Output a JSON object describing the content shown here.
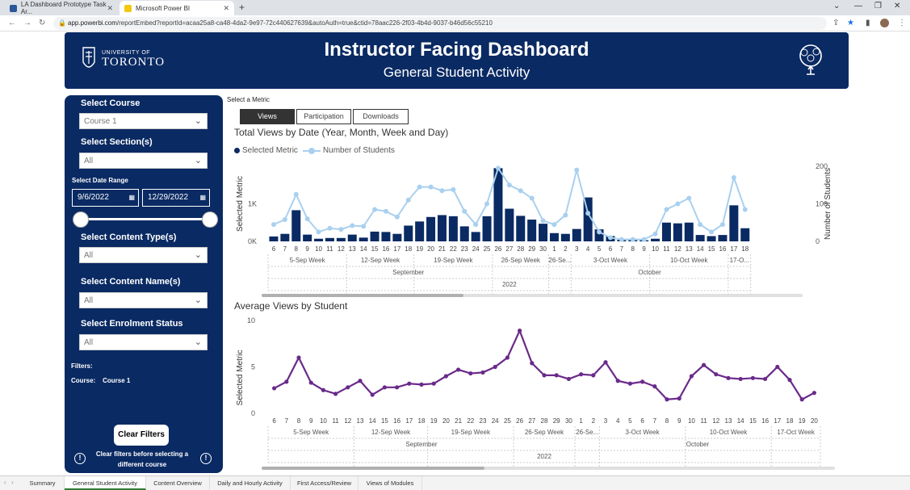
{
  "browser": {
    "tabs": [
      {
        "label": "LA Dashboard Prototype Task Ar...",
        "active": false
      },
      {
        "label": "Microsoft Power BI",
        "active": true
      }
    ],
    "url_host": "app.powerbi.com",
    "url_path": "/reportEmbed?reportId=acaa25a8-ca48-4da2-9e97-72c440627639&autoAuth=true&ctid=78aac226-2f03-4b4d-9037-b46d56c55210"
  },
  "header": {
    "logo_small": "UNIVERSITY OF",
    "logo_big": "TORONTO",
    "title": "Instructor Facing Dashboard",
    "subtitle": "General Student Activity"
  },
  "filters": {
    "course_label": "Select Course",
    "course_value": "Course 1",
    "section_label": "Select Section(s)",
    "section_value": "All",
    "date_label": "Select Date Range",
    "date_start": "9/6/2022",
    "date_end": "12/29/2022",
    "content_type_label": "Select Content Type(s)",
    "content_type_value": "All",
    "content_name_label": "Select Content Name(s)",
    "content_name_value": "All",
    "enrolment_label": "Select Enrolment Status",
    "enrolment_value": "All",
    "summary_title": "Filters:",
    "summary_course_key": "Course:",
    "summary_course_value": "Course 1",
    "clear_button": "Clear Filters",
    "clear_note": "Clear filters before selecting a different course"
  },
  "metric": {
    "label": "Select a Metric",
    "options": [
      "Views",
      "Participation",
      "Downloads"
    ],
    "selected": "Views"
  },
  "chart_data": [
    {
      "type": "bar",
      "title": "Total Views by Date (Year, Month, Week and Day)",
      "legend": [
        "Selected Metric",
        "Number of Students"
      ],
      "ylabel": "Selected Metric",
      "y2label": "Number of Students",
      "y_ticks": [
        "0K",
        "1K"
      ],
      "y2_ticks": [
        "0",
        "100",
        "200"
      ],
      "ylim": [
        0,
        2000
      ],
      "y2lim": [
        0,
        200
      ],
      "categories": [
        "6",
        "7",
        "8",
        "9",
        "10",
        "11",
        "12",
        "13",
        "14",
        "15",
        "16",
        "17",
        "18",
        "19",
        "20",
        "21",
        "22",
        "23",
        "24",
        "25",
        "26",
        "27",
        "28",
        "29",
        "30",
        "1",
        "2",
        "3",
        "4",
        "5",
        "6",
        "7",
        "8",
        "9",
        "10",
        "11",
        "12",
        "13",
        "14",
        "15",
        "16",
        "17",
        "18"
      ],
      "series": [
        {
          "name": "Selected Metric",
          "kind": "bar",
          "color": "#0a2a63",
          "values": [
            130,
            200,
            830,
            180,
            70,
            90,
            90,
            180,
            100,
            260,
            250,
            200,
            420,
            530,
            650,
            700,
            670,
            400,
            250,
            670,
            1950,
            870,
            680,
            580,
            470,
            220,
            200,
            330,
            1170,
            320,
            140,
            40,
            40,
            30,
            70,
            500,
            480,
            500,
            170,
            140,
            170,
            960,
            350
          ]
        },
        {
          "name": "Number of Students",
          "kind": "line",
          "color": "#a9d0ef",
          "values": [
            45,
            58,
            125,
            60,
            25,
            35,
            32,
            42,
            40,
            85,
            80,
            65,
            110,
            145,
            145,
            135,
            138,
            80,
            45,
            100,
            195,
            150,
            135,
            115,
            55,
            45,
            70,
            190,
            75,
            25,
            10,
            5,
            5,
            5,
            20,
            85,
            100,
            115,
            45,
            25,
            45,
            170,
            85
          ]
        }
      ],
      "x_groups_week": [
        "5-Sep Week",
        "12-Sep Week",
        "19-Sep Week",
        "26-Sep Week",
        "26-Se...",
        "3-Oct Week",
        "10-Oct Week",
        "17-O..."
      ],
      "x_groups_month": [
        "September",
        "October"
      ],
      "x_groups_year": [
        "2022"
      ]
    },
    {
      "type": "line",
      "title": "Average Views by Student",
      "ylabel": "Selected Metric",
      "y_ticks": [
        "0",
        "5",
        "10"
      ],
      "ylim": [
        0,
        10
      ],
      "categories": [
        "6",
        "7",
        "8",
        "9",
        "10",
        "11",
        "12",
        "13",
        "14",
        "15",
        "16",
        "17",
        "18",
        "19",
        "20",
        "21",
        "22",
        "23",
        "24",
        "25",
        "26",
        "27",
        "28",
        "29",
        "30",
        "1",
        "2",
        "3",
        "4",
        "5",
        "6",
        "7",
        "8",
        "9",
        "10",
        "11",
        "12",
        "13",
        "14",
        "15",
        "16",
        "17",
        "18",
        "19",
        "20"
      ],
      "series": [
        {
          "name": "Selected Metric",
          "color": "#6a2a8a",
          "values": [
            2.7,
            3.4,
            6.0,
            3.3,
            2.5,
            2.1,
            2.8,
            3.5,
            2.0,
            2.8,
            2.8,
            3.2,
            3.1,
            3.2,
            4.0,
            4.7,
            4.3,
            4.4,
            5.0,
            6.0,
            8.9,
            5.4,
            4.1,
            4.1,
            3.7,
            4.2,
            4.1,
            5.5,
            3.5,
            3.2,
            3.4,
            2.9,
            1.5,
            1.6,
            4.0,
            5.2,
            4.2,
            3.8,
            3.7,
            3.8,
            3.7,
            5.0,
            3.6,
            1.5,
            2.2
          ]
        }
      ],
      "x_groups_week": [
        "5-Sep Week",
        "12-Sep Week",
        "19-Sep Week",
        "26-Sep Week",
        "26-Se...",
        "3-Oct Week",
        "10-Oct Week",
        "17-Oct Week"
      ],
      "x_groups_month": [
        "September",
        "October"
      ],
      "x_groups_year": [
        "2022"
      ]
    }
  ],
  "bottom_tabs": [
    "Summary",
    "General Student Activity",
    "Content Overview",
    "Daily and Hourly Activity",
    "First Access/Review",
    "Views of Modules"
  ],
  "bottom_tab_active": "General Student Activity"
}
